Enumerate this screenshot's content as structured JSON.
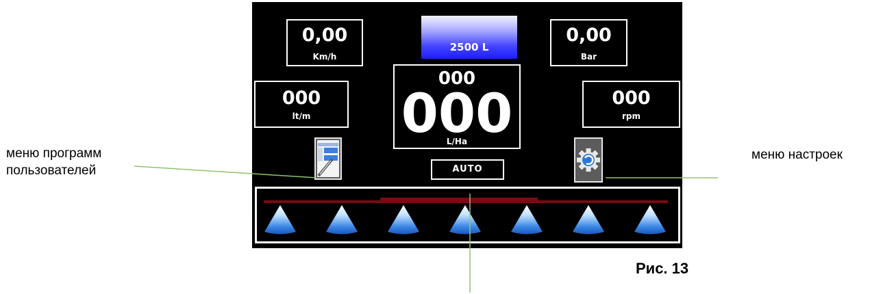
{
  "annotations": {
    "user_programs_line1": "меню программ",
    "user_programs_line2": "пользователей",
    "settings_menu": "меню настроек",
    "figure_label": "Рис. 13"
  },
  "screen": {
    "speed": {
      "value": "0,00",
      "unit": "Km/h"
    },
    "pressure": {
      "value": "0,00",
      "unit": "Bar"
    },
    "tank": {
      "label": "2500 L"
    },
    "flow": {
      "value": "000",
      "unit": "lt/m"
    },
    "rpm": {
      "value": "000",
      "unit": "rpm"
    },
    "rate": {
      "target": "000",
      "value": "000",
      "unit": "L/Ha"
    },
    "mode": "AUTO",
    "nozzle_count": 7
  },
  "colors": {
    "screen_bg": "#000000",
    "tank_fill": "#1d1dff",
    "annotation_line": "#8fc46a",
    "boom_line": "#7a0a14",
    "nozzle": "#2f7de0"
  },
  "icons": {
    "user_programs": "user-programs-icon",
    "settings": "settings-gear-icon",
    "nozzle": "nozzle-icon"
  }
}
